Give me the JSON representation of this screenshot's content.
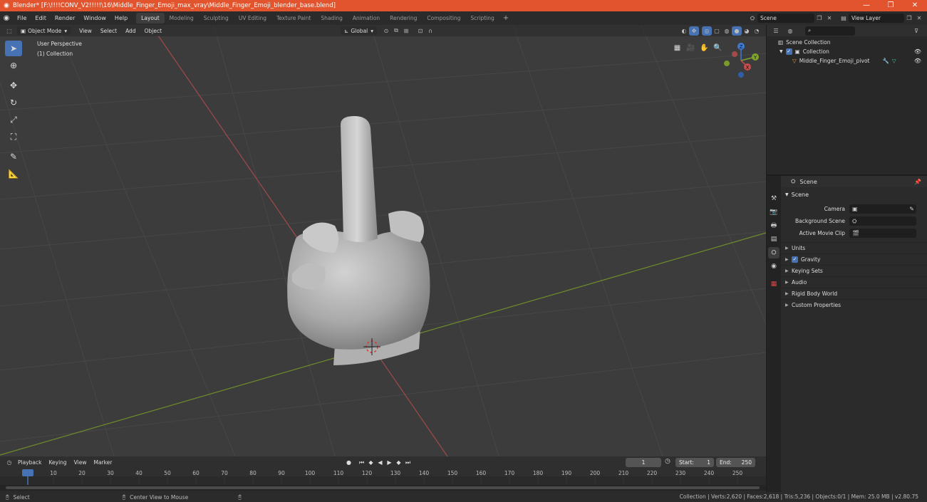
{
  "window": {
    "title": "Blender* [F:\\!!!!CONV_V2!!!!!\\16\\Middle_Finger_Emoji_max_vray\\Middle_Finger_Emoji_blender_base.blend]",
    "minimize": "—",
    "maximize": "❐",
    "close": "✕"
  },
  "menubar": {
    "items": [
      "File",
      "Edit",
      "Render",
      "Window",
      "Help"
    ],
    "workspaces": [
      "Layout",
      "Modeling",
      "Sculpting",
      "UV Editing",
      "Texture Paint",
      "Shading",
      "Animation",
      "Rendering",
      "Compositing",
      "Scripting"
    ],
    "active_workspace": "Layout",
    "scene_name": "Scene",
    "view_layer": "View Layer"
  },
  "viewport": {
    "mode": "Object Mode",
    "menus": [
      "View",
      "Select",
      "Add",
      "Object"
    ],
    "transform_orientation": "Global",
    "perspective_label": "User Perspective",
    "collection_label": "(1) Collection",
    "gizmo_axes": {
      "x": "X",
      "y": "Y",
      "z": "Z"
    }
  },
  "timeline": {
    "menus": [
      "Playback",
      "Keying",
      "View",
      "Marker"
    ],
    "current_frame": "1",
    "start_label": "Start:",
    "start_value": "1",
    "end_label": "End:",
    "end_value": "250",
    "ruler_marks": [
      "1",
      "10",
      "20",
      "30",
      "40",
      "50",
      "60",
      "70",
      "80",
      "90",
      "100",
      "110",
      "120",
      "130",
      "140",
      "150",
      "160",
      "170",
      "180",
      "190",
      "200",
      "210",
      "220",
      "230",
      "240",
      "250"
    ]
  },
  "statusbar": {
    "select": "Select",
    "center_view": "Center View to Mouse",
    "stats": "Collection | Verts:2,620 | Faces:2,618 | Tris:5,236 | Objects:0/1 | Mem: 25.0 MB | v2.80.75"
  },
  "outliner": {
    "scene_collection": "Scene Collection",
    "collection": "Collection",
    "object": "Middle_Finger_Emoji_pivot"
  },
  "properties": {
    "header_title": "Scene",
    "panel_title": "Scene",
    "camera_label": "Camera",
    "background_scene_label": "Background Scene",
    "active_movie_clip_label": "Active Movie Clip",
    "sub_panels": {
      "units": "Units",
      "gravity": "Gravity",
      "keying_sets": "Keying Sets",
      "audio": "Audio",
      "rigid_body_world": "Rigid Body World",
      "custom_properties": "Custom Properties"
    }
  },
  "colors": {
    "title_bar": "#e2542d",
    "accent_blue": "#4772b3",
    "axis_x": "#c94b4b",
    "axis_y": "#7fa52a",
    "axis_z": "#3c7bd6"
  }
}
